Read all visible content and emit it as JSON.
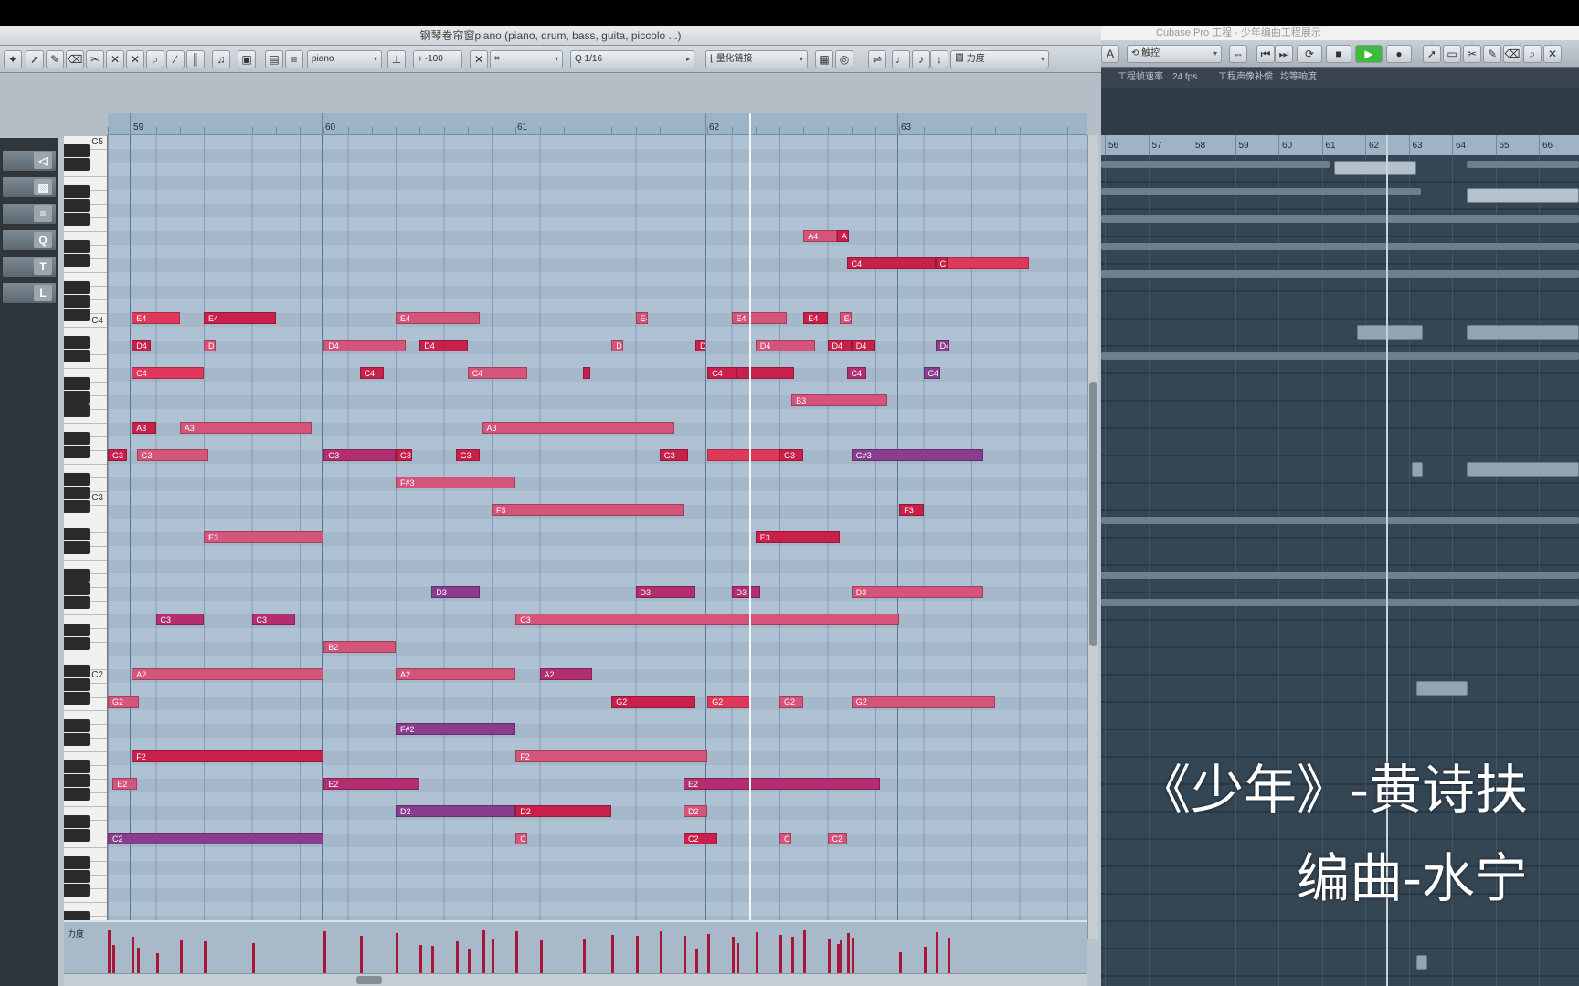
{
  "piano_roll": {
    "title": "钢琴卷帘窗piano (piano, drum, bass, guita, piccolo ...)",
    "toolbar": {
      "track_select": "piano",
      "velocity": "-100",
      "quantize": "1/16",
      "quantize_link": "量化链接",
      "controller": "力度"
    },
    "key_labels": [
      "C5",
      "C4",
      "C3",
      "C2"
    ],
    "bars": [
      "59",
      "60",
      "61",
      "62",
      "63"
    ],
    "velocity_lane_label": "力度",
    "notes": [
      {
        "label": "E4",
        "row": 5,
        "beat": 1,
        "len": 2,
        "v": "v1"
      },
      {
        "label": "E4",
        "row": 5,
        "beat": 4,
        "len": 3,
        "v": "v5"
      },
      {
        "label": "E4",
        "row": 5,
        "beat": 12,
        "len": 3.5,
        "v": "v2"
      },
      {
        "label": "E4",
        "row": 5,
        "beat": 22,
        "len": 0.5,
        "v": "v2"
      },
      {
        "label": "E4",
        "row": 5,
        "beat": 26,
        "len": 2.3,
        "v": "v2"
      },
      {
        "label": "E4",
        "row": 5,
        "beat": 29,
        "len": 1,
        "v": "v5"
      },
      {
        "label": "E4",
        "row": 5,
        "beat": 30.5,
        "len": 0.5,
        "v": "v2"
      },
      {
        "label": "A4",
        "row": 2,
        "beat": 29,
        "len": 1.4,
        "v": "v2"
      },
      {
        "label": "A",
        "row": 2,
        "beat": 30.4,
        "len": 0.5,
        "v": "v5"
      },
      {
        "label": "C4",
        "row": 3,
        "beat": 30.8,
        "len": 3.7,
        "v": "v5"
      },
      {
        "label": "C",
        "row": 3,
        "beat": 34.5,
        "len": 0.5,
        "v": "v5"
      },
      {
        "label": "",
        "row": 3,
        "beat": 35,
        "len": 3.4,
        "v": "v1"
      },
      {
        "label": "D4",
        "row": 6,
        "beat": 1,
        "len": 0.8,
        "v": "v5"
      },
      {
        "label": "D",
        "row": 6,
        "beat": 4,
        "len": 0.5,
        "v": "v2"
      },
      {
        "label": "D4",
        "row": 6,
        "beat": 9,
        "len": 3.4,
        "v": "v2"
      },
      {
        "label": "D4",
        "row": 6,
        "beat": 13,
        "len": 2,
        "v": "v5"
      },
      {
        "label": "D",
        "row": 6,
        "beat": 21,
        "len": 0.5,
        "v": "v2"
      },
      {
        "label": "D",
        "row": 6,
        "beat": 24.5,
        "len": 0.4,
        "v": "v5"
      },
      {
        "label": "D4",
        "row": 6,
        "beat": 27,
        "len": 2.5,
        "v": "v2"
      },
      {
        "label": "D4",
        "row": 6,
        "beat": 30,
        "len": 1,
        "v": "v5"
      },
      {
        "label": "D4",
        "row": 6,
        "beat": 31,
        "len": 1,
        "v": "v5"
      },
      {
        "label": "D4",
        "row": 6,
        "beat": 34.5,
        "len": 0.6,
        "v": "v4"
      },
      {
        "label": "C4",
        "row": 7,
        "beat": 1,
        "len": 3,
        "v": "v1"
      },
      {
        "label": "C4",
        "row": 7,
        "beat": 10.5,
        "len": 1,
        "v": "v5"
      },
      {
        "label": "C4",
        "row": 7,
        "beat": 15,
        "len": 2.5,
        "v": "v2"
      },
      {
        "label": "",
        "row": 7,
        "beat": 19.8,
        "len": 0.3,
        "v": "v5"
      },
      {
        "label": "C4",
        "row": 7,
        "beat": 25,
        "len": 1.2,
        "v": "v5"
      },
      {
        "label": "",
        "row": 7,
        "beat": 26.2,
        "len": 2.4,
        "v": "v5"
      },
      {
        "label": "C4",
        "row": 7,
        "beat": 30.8,
        "len": 0.8,
        "v": "v3"
      },
      {
        "label": "C4",
        "row": 7,
        "beat": 34,
        "len": 0.7,
        "v": "v4"
      },
      {
        "label": "B3",
        "row": 8,
        "beat": 28.5,
        "len": 4,
        "v": "v2"
      },
      {
        "label": "A3",
        "row": 9,
        "beat": 1,
        "len": 1,
        "v": "v5"
      },
      {
        "label": "A3",
        "row": 9,
        "beat": 3,
        "len": 5.5,
        "v": "v2"
      },
      {
        "label": "A3",
        "row": 9,
        "beat": 15.6,
        "len": 8,
        "v": "v2"
      },
      {
        "label": "G#3",
        "row": 10,
        "beat": 31,
        "len": 5.5,
        "v": "v4"
      },
      {
        "label": "G3",
        "row": 10,
        "beat": 0,
        "len": 0.8,
        "v": "v5"
      },
      {
        "label": "G3",
        "row": 10,
        "beat": 1.2,
        "len": 3,
        "v": "v2"
      },
      {
        "label": "G3",
        "row": 10,
        "beat": 9,
        "len": 3,
        "v": "v3"
      },
      {
        "label": "G3",
        "row": 10,
        "beat": 12,
        "len": 0.7,
        "v": "v5"
      },
      {
        "label": "G3",
        "row": 10,
        "beat": 14.5,
        "len": 1,
        "v": "v5"
      },
      {
        "label": "G3",
        "row": 10,
        "beat": 23,
        "len": 1.2,
        "v": "v5"
      },
      {
        "label": "",
        "row": 10,
        "beat": 25,
        "len": 3,
        "v": "v1"
      },
      {
        "label": "G3",
        "row": 10,
        "beat": 28,
        "len": 1,
        "v": "v5"
      },
      {
        "label": "F#3",
        "row": 11,
        "beat": 12,
        "len": 5,
        "v": "v2"
      },
      {
        "label": "F3",
        "row": 12,
        "beat": 16,
        "len": 8,
        "v": "v2"
      },
      {
        "label": "F3",
        "row": 12,
        "beat": 33,
        "len": 1,
        "v": "v5"
      },
      {
        "label": "E3",
        "row": 13,
        "beat": 4,
        "len": 5,
        "v": "v2"
      },
      {
        "label": "E3",
        "row": 13,
        "beat": 27,
        "len": 3.5,
        "v": "v5"
      },
      {
        "label": "D3",
        "row": 15,
        "beat": 13.5,
        "len": 2,
        "v": "v4"
      },
      {
        "label": "D3",
        "row": 15,
        "beat": 22,
        "len": 2.5,
        "v": "v3"
      },
      {
        "label": "D3",
        "row": 15,
        "beat": 26,
        "len": 1.2,
        "v": "v3"
      },
      {
        "label": "D3",
        "row": 15,
        "beat": 31,
        "len": 5.5,
        "v": "v2"
      },
      {
        "label": "C3",
        "row": 16,
        "beat": 2,
        "len": 2,
        "v": "v3"
      },
      {
        "label": "C3",
        "row": 16,
        "beat": 6,
        "len": 1.8,
        "v": "v3"
      },
      {
        "label": "C3",
        "row": 16,
        "beat": 17,
        "len": 16,
        "v": "v2"
      },
      {
        "label": "B2",
        "row": 17,
        "beat": 9,
        "len": 3,
        "v": "v2"
      },
      {
        "label": "A2",
        "row": 18,
        "beat": 1,
        "len": 8,
        "v": "v2"
      },
      {
        "label": "A2",
        "row": 18,
        "beat": 12,
        "len": 5,
        "v": "v2"
      },
      {
        "label": "A2",
        "row": 18,
        "beat": 18,
        "len": 2.2,
        "v": "v3"
      },
      {
        "label": "G2",
        "row": 19,
        "beat": 0,
        "len": 1.3,
        "v": "v2"
      },
      {
        "label": "G2",
        "row": 19,
        "beat": 21,
        "len": 3.5,
        "v": "v5"
      },
      {
        "label": "G2",
        "row": 19,
        "beat": 25,
        "len": 1.8,
        "v": "v1"
      },
      {
        "label": "G2",
        "row": 19,
        "beat": 28,
        "len": 1,
        "v": "v2"
      },
      {
        "label": "G2",
        "row": 19,
        "beat": 31,
        "len": 6,
        "v": "v2"
      },
      {
        "label": "F#2",
        "row": 20,
        "beat": 12,
        "len": 5,
        "v": "v4"
      },
      {
        "label": "F2",
        "row": 21,
        "beat": 1,
        "len": 8,
        "v": "v5"
      },
      {
        "label": "F2",
        "row": 21,
        "beat": 17,
        "len": 8,
        "v": "v2"
      },
      {
        "label": "E2",
        "row": 22,
        "beat": 0.2,
        "len": 1,
        "v": "v2"
      },
      {
        "label": "E2",
        "row": 22,
        "beat": 9,
        "len": 4,
        "v": "v3"
      },
      {
        "label": "E2",
        "row": 22,
        "beat": 24,
        "len": 8.2,
        "v": "v3"
      },
      {
        "label": "D2",
        "row": 23,
        "beat": 12,
        "len": 5,
        "v": "v4"
      },
      {
        "label": "D2",
        "row": 23,
        "beat": 17,
        "len": 4,
        "v": "v5"
      },
      {
        "label": "D2",
        "row": 23,
        "beat": 24,
        "len": 1,
        "v": "v2"
      },
      {
        "label": "C2",
        "row": 24,
        "beat": 0,
        "len": 9,
        "v": "v4"
      },
      {
        "label": "C2",
        "row": 24,
        "beat": 17,
        "len": 0.5,
        "v": "v2"
      },
      {
        "label": "C2",
        "row": 24,
        "beat": 24,
        "len": 1.4,
        "v": "v5"
      },
      {
        "label": "C2",
        "row": 24,
        "beat": 28,
        "len": 0.5,
        "v": "v2"
      },
      {
        "label": "C2",
        "row": 24,
        "beat": 30,
        "len": 0.8,
        "v": "v2"
      }
    ]
  },
  "cubase": {
    "title": "Cubase Pro 工程 - 少年编曲工程展示",
    "toolbar": {
      "mode_label": "触控"
    },
    "info": [
      "工程帧速率",
      "24 fps",
      "工程声像补偿",
      "均等响度"
    ],
    "bars": [
      "56",
      "57",
      "58",
      "59",
      "60",
      "61",
      "62",
      "63",
      "64",
      "65",
      "66"
    ]
  },
  "overlay": {
    "title": "《少年》-黄诗扶",
    "subtitle": "编曲-水宁"
  },
  "colors": {
    "note_red": "#e0385a",
    "note_pink": "#d4547a",
    "note_magenta": "#b32e6e",
    "note_purple": "#8a3c8e",
    "velocity": "#a8173a"
  }
}
